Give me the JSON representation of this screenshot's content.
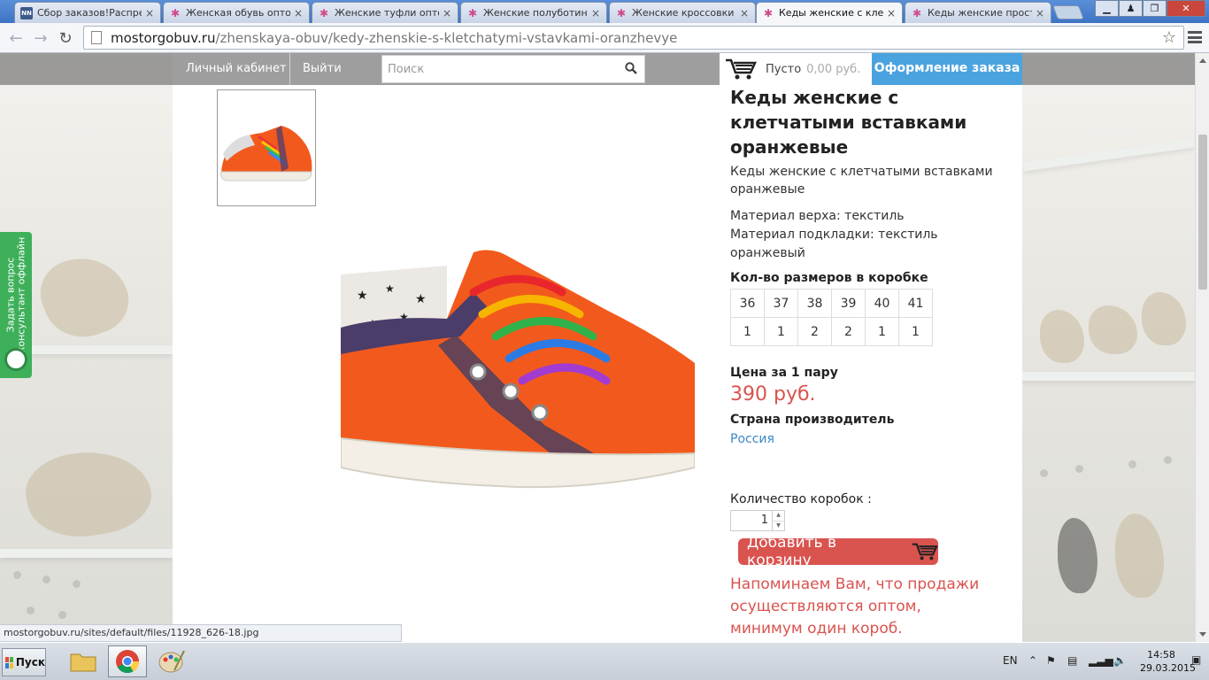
{
  "browser": {
    "tabs": [
      {
        "title": "Сбор заказов!Распределение",
        "icon": "nn-favicon",
        "active": false
      },
      {
        "title": "Женская обувь оптом",
        "icon": "site-favicon",
        "active": false
      },
      {
        "title": "Женские туфли оптом",
        "icon": "site-favicon",
        "active": false
      },
      {
        "title": "Женские полуботинки",
        "icon": "site-favicon",
        "active": false
      },
      {
        "title": "Женские кроссовки оптом",
        "icon": "site-favicon",
        "active": false
      },
      {
        "title": "Кеды женские с клетчатыми",
        "icon": "site-favicon",
        "active": true
      },
      {
        "title": "Кеды женские простого",
        "icon": "site-favicon",
        "active": false
      }
    ],
    "nn_badge": "NN",
    "url_host": "mostorgobuv.ru",
    "url_path": "/zhenskaya-obuv/kedy-zhenskie-s-kletchatymi-vstavkami-oranzhevye",
    "status_url": "mostorgobuv.ru/sites/default/files/11928_626-18.jpg"
  },
  "site": {
    "account_link": "Личный кабинет",
    "logout_link": "Выйти",
    "search_placeholder": "Поиск",
    "cart_label": "Пусто",
    "cart_sum": "0,00 руб.",
    "checkout_label": "Оформление заказа",
    "feedback_line1": "Задать вопрос",
    "feedback_line2": "консультант оффлайн"
  },
  "product": {
    "title": "Кеды женские с клетчатыми вставками оранжевые",
    "subtitle": "Кеды женские с клетчатыми вставками оранжевые",
    "material_top": "Материал верха: текстиль",
    "material_lining": "Материал подкладки: текстиль",
    "color": "оранжевый",
    "sizes_heading": "Кол-во размеров в коробке",
    "sizes": [
      "36",
      "37",
      "38",
      "39",
      "40",
      "41"
    ],
    "size_counts": [
      "1",
      "1",
      "2",
      "2",
      "1",
      "1"
    ],
    "price_heading": "Цена за 1 пару",
    "price": "390 руб.",
    "country_heading": "Страна производитель",
    "country": "Россия",
    "qty_label": "Количество коробок :",
    "qty_value": "1",
    "add_to_cart": "Добавить в корзину",
    "notice": "Напоминаем Вам, что продажи осуществляются оптом, минимум один короб."
  },
  "taskbar": {
    "start_label": "Пуск",
    "lang": "EN",
    "time": "14:58",
    "date": "29.03.2015"
  },
  "colors": {
    "accent_blue": "#4aa3df",
    "price_red": "#d9534f",
    "feedback_green": "#3eb05a",
    "shoe_orange": "#f25a1d"
  }
}
